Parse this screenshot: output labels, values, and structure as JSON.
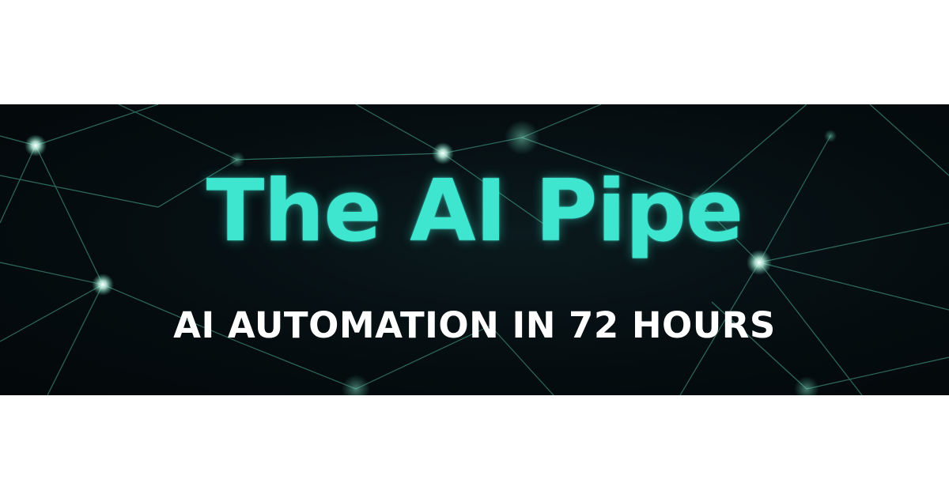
{
  "banner": {
    "title": "The AI Pipe",
    "subtitle": "AI AUTOMATION IN 72 HOURS"
  },
  "colors": {
    "page_background": "#ffffff",
    "banner_background": "#050d10",
    "title_color": "#3ee6d0",
    "subtitle_color": "#ffffff",
    "network_line_color": "#4fb89a",
    "node_glow_color": "#bff7e6"
  }
}
